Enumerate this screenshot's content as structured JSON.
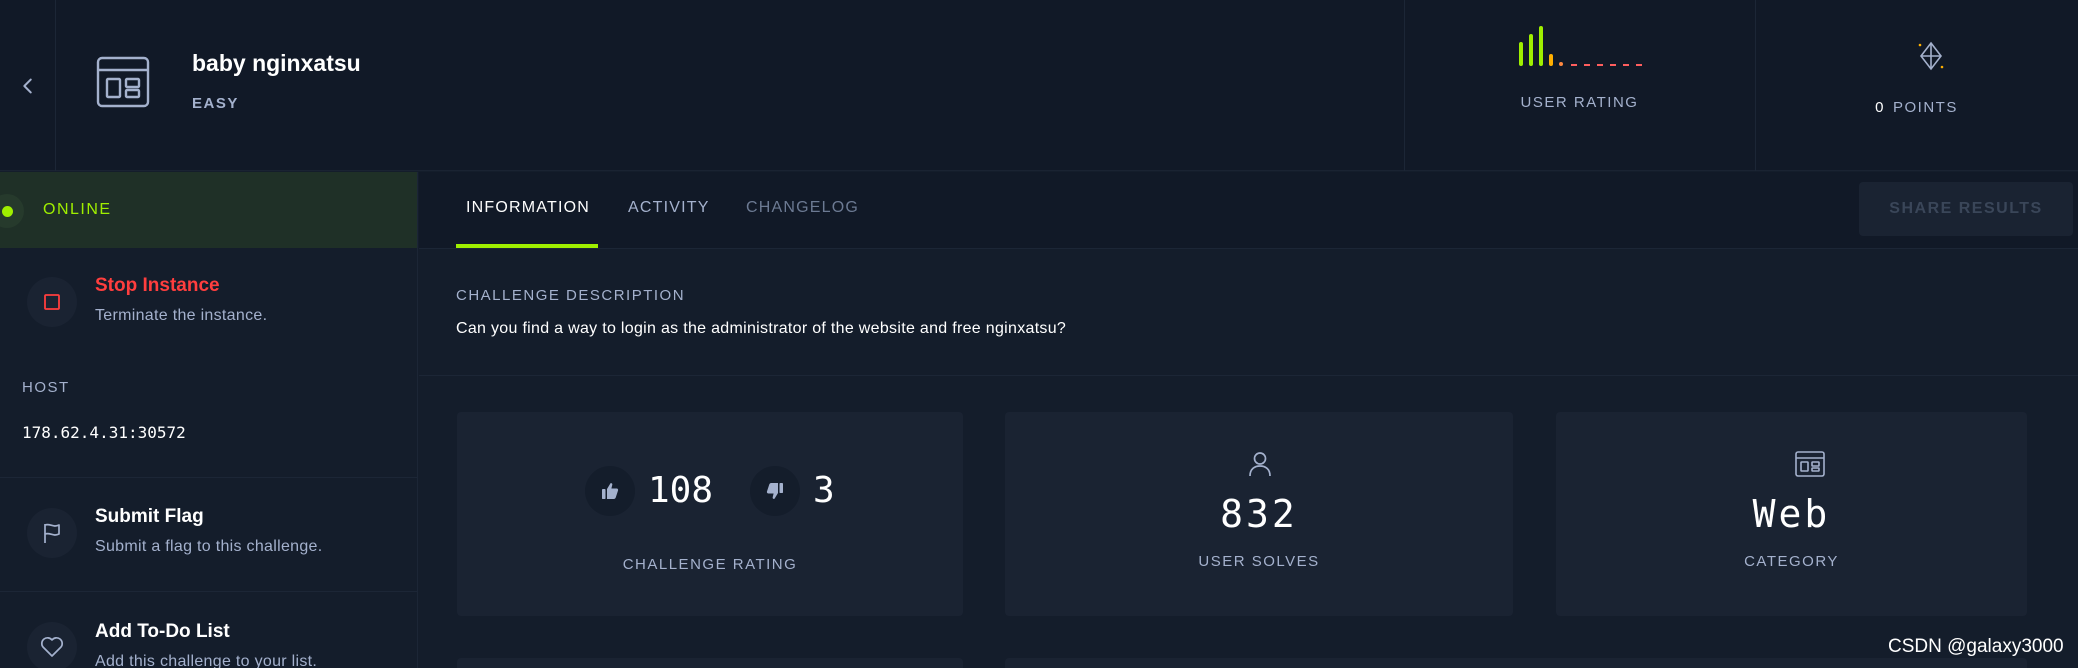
{
  "header": {
    "title": "baby nginxatsu",
    "difficulty": "EASY",
    "rating_label": "USER RATING",
    "points_value": "0",
    "points_label": "POINTS"
  },
  "user_rating_bars": {
    "colors": [
      "#9fef00",
      "#9fef00",
      "#9fef00",
      "#ffaf00",
      "#ff8840",
      "#ff5e5e"
    ]
  },
  "sidebar": {
    "status": "ONLINE",
    "stop": {
      "title": "Stop Instance",
      "subtitle": "Terminate the instance."
    },
    "host_label": "HOST",
    "host_value": "178.62.4.31:30572",
    "submit": {
      "title": "Submit Flag",
      "subtitle": "Submit a flag to this challenge."
    },
    "todo": {
      "title": "Add To-Do List",
      "subtitle": "Add this challenge to your list."
    }
  },
  "tabs": [
    {
      "label": "INFORMATION"
    },
    {
      "label": "ACTIVITY"
    },
    {
      "label": "CHANGELOG"
    }
  ],
  "share_button": "SHARE RESULTS",
  "description": {
    "label": "CHALLENGE DESCRIPTION",
    "text": "Can you find a way to login as the administrator of the website and free nginxatsu?"
  },
  "stats": {
    "upvotes": "108",
    "downvotes": "3",
    "rating_label": "CHALLENGE RATING",
    "solves": "832",
    "solves_label": "USER SOLVES",
    "category": "Web",
    "category_label": "CATEGORY"
  },
  "colors": {
    "accent": "#9fef00",
    "danger": "#ff3e3e",
    "background": "#141d2b",
    "panel": "#1a2332"
  },
  "watermark": "CSDN @galaxy3000"
}
